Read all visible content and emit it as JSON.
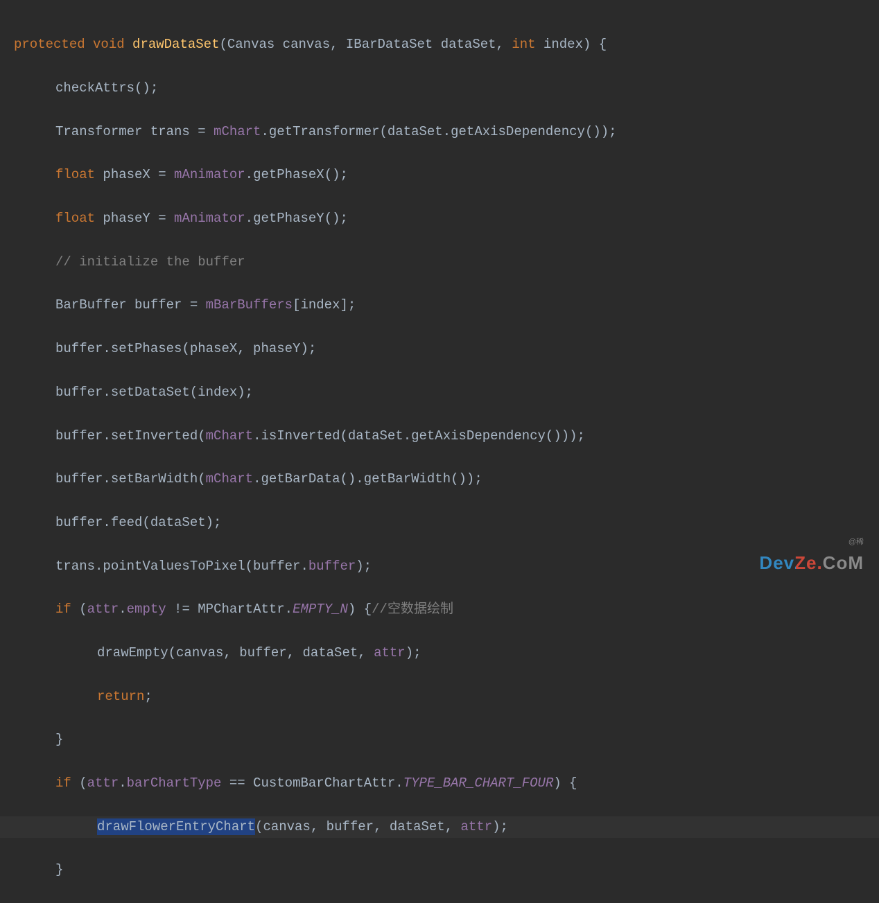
{
  "code": {
    "l1": {
      "protected": "protected",
      "void": "void",
      "method": "drawDataSet",
      "params": "(Canvas canvas, IBarDataSet dataSet, ",
      "int": "int",
      "params2": " index) {"
    },
    "l2": "checkAttrs();",
    "l3": {
      "pre": "Transformer trans = ",
      "field": "mChart",
      "post": ".getTransformer(dataSet.getAxisDependency());"
    },
    "l4": {
      "float": "float",
      "pre": " phaseX = ",
      "field": "mAnimator",
      "post": ".getPhaseX();"
    },
    "l5": {
      "float": "float",
      "pre": " phaseY = ",
      "field": "mAnimator",
      "post": ".getPhaseY();"
    },
    "l6": "// initialize the buffer",
    "l7": {
      "pre": "BarBuffer buffer = ",
      "field": "mBarBuffers",
      "post": "[index];"
    },
    "l8": "buffer.setPhases(phaseX, phaseY);",
    "l9": "buffer.setDataSet(index);",
    "l10": {
      "pre": "buffer.setInverted(",
      "field": "mChart",
      "post": ".isInverted(dataSet.getAxisDependency()));"
    },
    "l11": {
      "pre": "buffer.setBarWidth(",
      "field": "mChart",
      "post": ".getBarData().getBarWidth());"
    },
    "l12": "buffer.feed(dataSet);",
    "l13": {
      "pre": "trans.pointValuesToPixel(buffer.",
      "field": "buffer",
      "post": ");"
    },
    "l14": {
      "if": "if",
      "pre": " (",
      "attr": "attr",
      "mid": ".",
      "empty": "empty",
      "mid2": " != MPChartAttr.",
      "const": "EMPTY_N",
      "post": ") {",
      "comment": "//空数据绘制"
    },
    "l15": {
      "pre": "drawEmpty(canvas, buffer, dataSet, ",
      "attr": "attr",
      "post": ");"
    },
    "l16": "return",
    "l16b": ";",
    "l17": "}",
    "l18": {
      "if": "if",
      "pre": " (",
      "attr": "attr",
      "mid": ".",
      "field": "barChartType",
      "mid2": " == CustomBarChartAttr.",
      "const": "TYPE_BAR_CHART_FOUR",
      "post": ") {"
    },
    "l19": {
      "sel": "drawFlowerEntryChart",
      "pre": "(canvas, buffer, dataSet, ",
      "attr": "attr",
      "post": ");"
    },
    "l20": "}"
  },
  "watermark": {
    "small": "@稀",
    "logo": "DevZe.CoM"
  }
}
